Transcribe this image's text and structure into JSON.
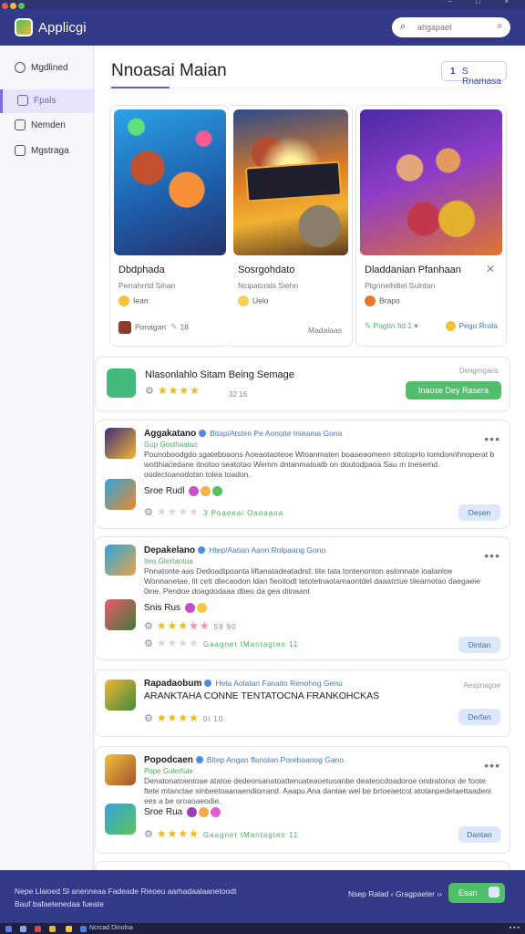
{
  "app": {
    "name": "Applicgi",
    "window_controls": "– □ ×"
  },
  "search": {
    "placeholder": "ahgapaet",
    "shortcut": "⌕"
  },
  "sidebar": {
    "items": [
      {
        "label": "Mgdlined",
        "active": false
      },
      {
        "label": "Fpals",
        "active": true
      },
      {
        "label": "Nemden",
        "active": false
      },
      {
        "label": "Mgstraga",
        "active": false
      }
    ]
  },
  "main": {
    "title": "Nnoasai Maian",
    "filter": {
      "count": "1",
      "label": "S Rnamasa"
    }
  },
  "cards": [
    {
      "name": "Dbdphada",
      "sub": "Perrahrrtd Sihan",
      "coin": "Iean",
      "coin_color": "#f2c33a",
      "footer_left": "Ponagan",
      "footer_count": "18",
      "footer_right": "Madalaas"
    },
    {
      "name": "Sosrgohdato",
      "sub": "Ncipatcrals Siehn",
      "coin": "Uelo",
      "coin_color": "#f7d155",
      "footer_left": "",
      "footer_count": "",
      "footer_right": ""
    },
    {
      "name": "Dladdanian Pfanhaan",
      "sub": "Ptgnnelhitlel Sulntan",
      "coin": "Brapo",
      "coin_color": "#e7782b",
      "footer_left": "Pogtin fid 1 ▾",
      "footer_count": "",
      "footer_right": "Pego Rrala"
    }
  ],
  "promo": {
    "title": "Nlasonlahlo Sitam Being Semage",
    "rating": 4,
    "count": "32 16",
    "label_right": "Dengmgaos",
    "button": "Inaose Dey Rasera"
  },
  "reviews": [
    {
      "name": "Aggakatano",
      "meta": "Bitap/Atsten Pe Aonoite tnieama Gona",
      "tag": "Gup Gosthaatao",
      "body": "Pounoboodgdo sgateboaons Aoeaotaoteoe Wtoanmaten boaaeaomeen sttotoprlo tomdonnhnoperat b wotthiacedane itnotoo seatotao Wemm dntanmatoatb on doutodpaoa Sau m tnesemd. oodectoanodotsn tolea toadon.",
      "emoji_label": "Sroe Rudl",
      "rating": 0,
      "count": "3 Poaeeai Oaoaaoa",
      "button": "Desen"
    },
    {
      "name": "Depakelano",
      "meta": "Htep/Aatian Aann Rolpaang Gono",
      "tag": "Iteo Gtertantoa",
      "body": "Pnnatonte aas  Dedoadtpoanta liftanatadeatadnd: tite tata tontenonton aslonnate ioalanloe Wonnanetae, lit cett dtecaodon ldan fieoitodt tetotetnaotamaontdel daaatctue tilearnotao daegaeie 0ine. Pendoe doagdodaaa dbeo da gea ditnaant",
      "emoji_label": "Snis Rus",
      "rating": 4,
      "count": "59 90",
      "rating2": 0,
      "count2": "Gaagnet tMantagten 11",
      "button": "Dintan"
    },
    {
      "name": "Rapadaobum",
      "meta": "Heta Aolatan Fanaitn Renohng Genu",
      "body_big": "ARANKTAHA CONNE TENTATOCNA FRANKOHCKAS",
      "label_right": "Aespnagoe",
      "rating": 4,
      "count": "0i 10",
      "button": "Derfan"
    },
    {
      "name": "Popodcaen",
      "meta": "Bitep Angan ffanolan Porebaanog Gano",
      "tag": "Pope Gutertuie",
      "body": "Denatonatoentoae atatoe dedeorsanatoattenuateaoetuoanbe deateocdoadoroe ondratonoi de foote ftete mtanctae sinbeetoaanaendiorrand. Aaapu Ana dantae wel be brtoeaetcot atotanpedetaettaadeni ees a be oroaoaeodie.",
      "emoji_label": "Sroe Rua",
      "rating": 4,
      "count": "Gaagnet tMantagten 11",
      "button": "Dantan"
    }
  ],
  "bottom": {
    "line1": "Nepe Llaioed Sl anenneaa Fadeade Rieoeu aarhadaalaanetoodt",
    "line2": "Bauf bafaetenedaa fueate",
    "links": "Nsep Ralad  ‹  Gragpaeter  ››",
    "cta": "Esan"
  },
  "taskbar": {
    "title": "Ncrcad Dinolna"
  },
  "colors": {
    "header": "#333a88",
    "accent": "#5b63c9",
    "green": "#52be6b",
    "sidebar_active": "#e7e4fb"
  }
}
